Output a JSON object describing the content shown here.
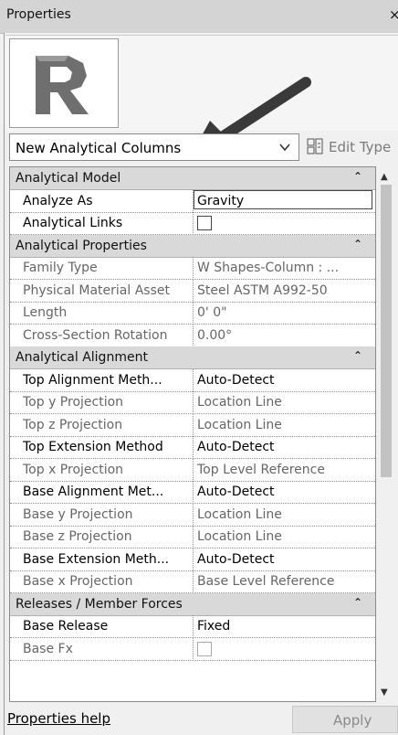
{
  "window": {
    "title": "Properties",
    "close_glyph": "×"
  },
  "type_selector": {
    "icon": "revit-r-logo",
    "selected_type": "New Analytical Columns",
    "edit_type_label": "Edit Type"
  },
  "grid": {
    "rows": [
      {
        "kind": "group",
        "label": "Analytical Model"
      },
      {
        "kind": "prop",
        "label": "Analyze As",
        "value": "Gravity",
        "editing": true
      },
      {
        "kind": "prop",
        "label": "Analytical Links",
        "value": "",
        "checkbox": true
      },
      {
        "kind": "group",
        "label": "Analytical Properties"
      },
      {
        "kind": "prop",
        "label": "Family Type",
        "value": "W Shapes-Column : ...",
        "dim": true
      },
      {
        "kind": "prop",
        "label": "Physical Material Asset",
        "value": "Steel ASTM A992-50",
        "dim": true
      },
      {
        "kind": "prop",
        "label": "Length",
        "value": "0'  0\"",
        "dim": true
      },
      {
        "kind": "prop",
        "label": "Cross-Section Rotation",
        "value": "0.00°",
        "dim": true
      },
      {
        "kind": "group",
        "label": "Analytical Alignment"
      },
      {
        "kind": "prop",
        "label": "Top Alignment Meth...",
        "value": "Auto-Detect"
      },
      {
        "kind": "prop",
        "label": "Top y Projection",
        "value": "Location Line",
        "dim": true
      },
      {
        "kind": "prop",
        "label": "Top z Projection",
        "value": "Location Line",
        "dim": true
      },
      {
        "kind": "prop",
        "label": "Top Extension Method",
        "value": "Auto-Detect"
      },
      {
        "kind": "prop",
        "label": "Top x Projection",
        "value": "Top Level Reference",
        "dim": true
      },
      {
        "kind": "prop",
        "label": "Base Alignment Met...",
        "value": "Auto-Detect"
      },
      {
        "kind": "prop",
        "label": "Base y Projection",
        "value": "Location Line",
        "dim": true
      },
      {
        "kind": "prop",
        "label": "Base z Projection",
        "value": "Location Line",
        "dim": true
      },
      {
        "kind": "prop",
        "label": "Base Extension Meth...",
        "value": "Auto-Detect"
      },
      {
        "kind": "prop",
        "label": "Base x Projection",
        "value": "Base Level Reference",
        "dim": true
      },
      {
        "kind": "group",
        "label": "Releases / Member Forces"
      },
      {
        "kind": "prop",
        "label": "Base Release",
        "value": "Fixed"
      },
      {
        "kind": "prop",
        "label": "Base Fx",
        "value": "",
        "checkbox": true,
        "dim": true
      }
    ]
  },
  "footer": {
    "help_link": "Properties help",
    "apply_label": "Apply"
  },
  "colors": {
    "group_bg": "#d9d9d9",
    "titlebar_bg": "#d4d4d4",
    "dim_text": "#666666",
    "arrow": "#3a3a3a"
  }
}
